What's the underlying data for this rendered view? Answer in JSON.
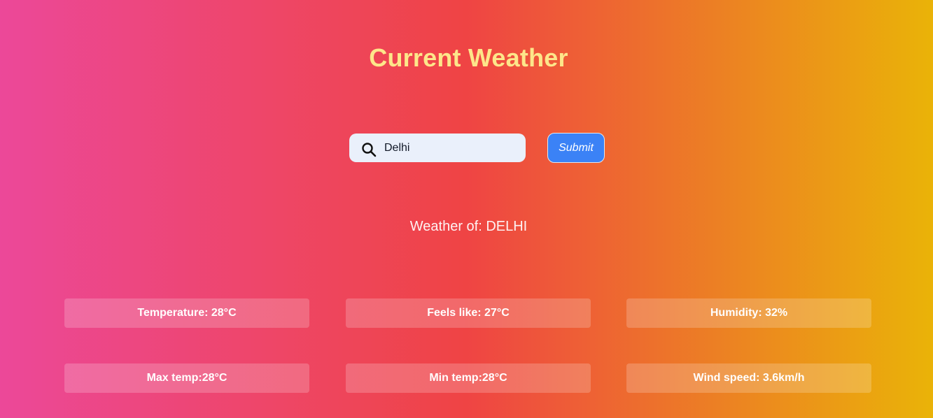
{
  "header": {
    "title": "Current Weather"
  },
  "search": {
    "value": "Delhi",
    "icon": "search-icon",
    "submit_label": "Submit"
  },
  "result": {
    "location_line": "Weather of: DELHI",
    "cards": [
      {
        "label": "Temperature: 28°C"
      },
      {
        "label": "Feels like: 27°C"
      },
      {
        "label": "Humidity: 32%"
      },
      {
        "label": "Max temp:28°C"
      },
      {
        "label": "Min temp:28°C"
      },
      {
        "label": "Wind speed: 3.6km/h"
      }
    ]
  },
  "colors": {
    "gradient_start": "#ec4899",
    "gradient_mid": "#ef4444",
    "gradient_end": "#eab308",
    "title": "#fde68a",
    "button": "#3b82f6",
    "search_bg": "#eaf0fb"
  }
}
